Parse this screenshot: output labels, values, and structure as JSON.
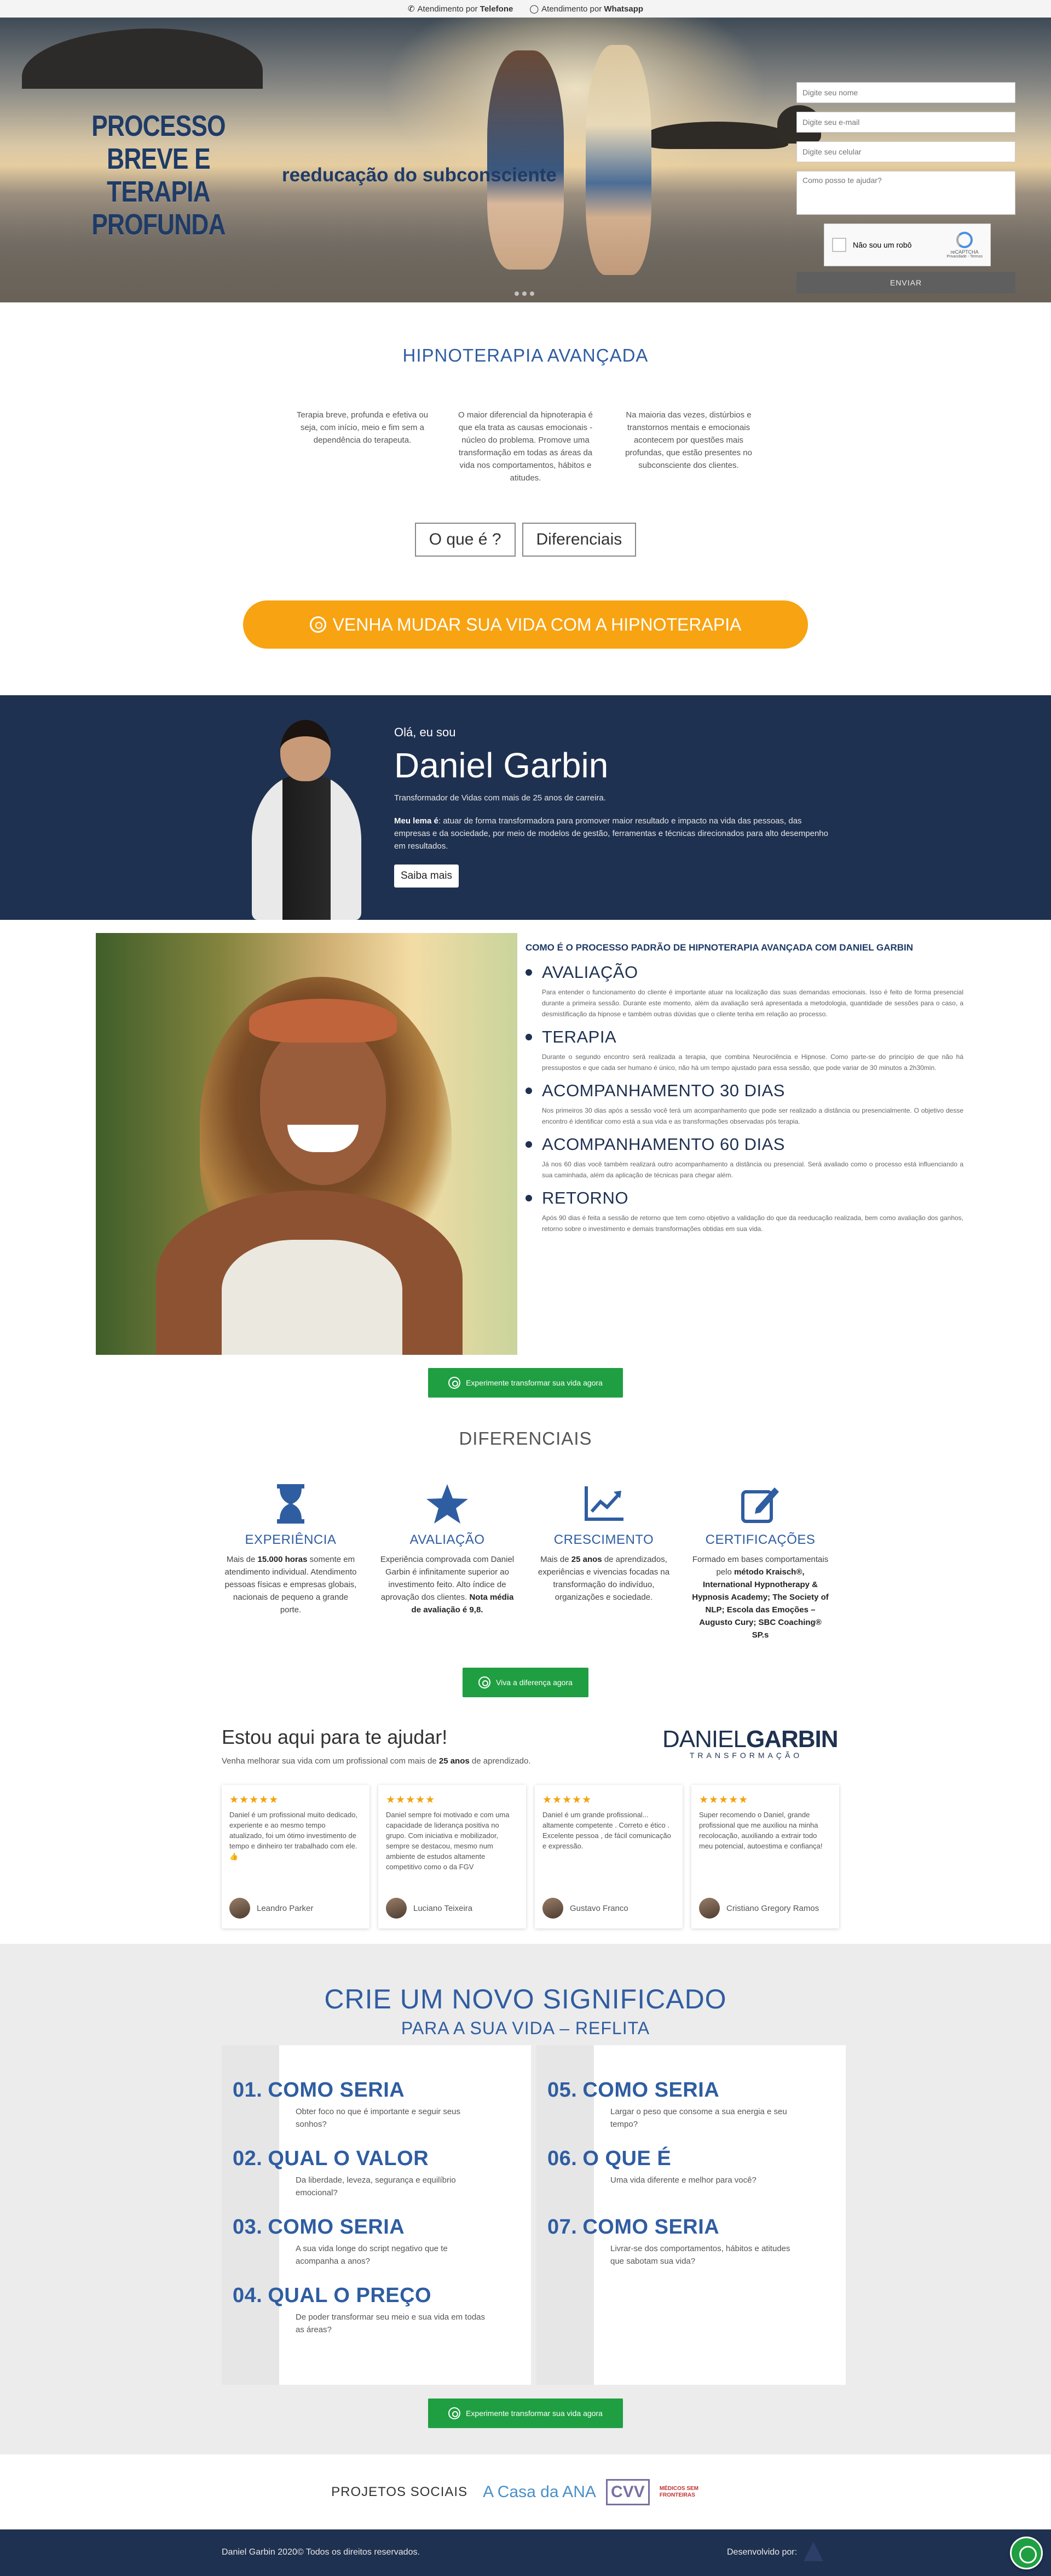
{
  "topbar": {
    "phone_prefix": "Atendimento por",
    "phone": "Telefone",
    "wa_prefix": "Atendimento por",
    "wa": "Whatsapp"
  },
  "hero": {
    "title_big": "PROCESSO BREVE E TERAPIA PROFUNDA",
    "title_small": "reeducação do subconsciente",
    "form": {
      "name_placeholder": "Digite seu nome",
      "email_placeholder": "Digite seu e-mail",
      "phone_placeholder": "Digite seu celular",
      "message_placeholder": "Como posso te ajudar?",
      "captcha_label": "Não sou um robô",
      "captcha_brand": "reCAPTCHA",
      "captcha_links": "Privacidade - Termos",
      "send_label": "ENVIAR"
    }
  },
  "hipno": {
    "title": "HIPNOTERAPIA AVANÇADA",
    "cols": [
      "Terapia breve, profunda e efetiva ou seja, com início, meio e fim sem a dependência do terapeuta.",
      "O maior diferencial da hipnoterapia é que ela trata as causas emocionais - núcleo do problema. Promove uma transformação em todas as áreas da vida nos comportamentos, hábitos e atitudes.",
      "Na maioria das vezes, distúrbios e transtornos mentais e emocionais acontecem por questões mais profundas, que estão presentes no subconsciente dos clientes."
    ],
    "tabs": [
      "O que é ?",
      "Diferenciais"
    ],
    "cta": "VENHA MUDAR SUA VIDA COM A HIPNOTERAPIA"
  },
  "about": {
    "hello": "Olá, eu sou",
    "name": "Daniel Garbin",
    "sub": "Transformador de Vidas com mais de 25 anos de carreira.",
    "lema_bold": "Meu lema é",
    "lema_rest": ": atuar de forma transformadora para promover maior resultado e impacto na vida das pessoas, das empresas e da sociedade, por meio de modelos de gestão, ferramentas e técnicas direcionados para alto desempenho em resultados.",
    "button": "Saiba mais"
  },
  "process": {
    "title": "COMO É O PROCESSO PADRÃO DE HIPNOTERAPIA AVANÇADA COM DANIEL GARBIN",
    "steps": [
      {
        "title": "AVALIAÇÃO",
        "text": "Para entender o funcionamento do cliente é importante atuar na localização das suas demandas emocionais. Isso é feito de forma presencial durante a primeira sessão. Durante este momento, além da avaliação será apresentada a metodologia, quantidade de sessões para o caso, a desmistificação da hipnose e também outras dúvidas que o cliente tenha em relação ao processo."
      },
      {
        "title": "TERAPIA",
        "text": "Durante o segundo encontro será realizada a terapia, que combina Neurociência e Hipnose. Como parte-se do princípio de que não há pressupostos e que cada ser humano é único, não há um tempo ajustado para essa sessão, que pode variar de 30 minutos a 2h30min."
      },
      {
        "title": "ACOMPANHAMENTO 30 DIAS",
        "text": "Nos primeiros 30 dias após a sessão você terá um acompanhamento que pode ser realizado a distância ou presencialmente. O objetivo desse encontro é identificar como está a sua vida e as transformações observadas pós terapia."
      },
      {
        "title": "ACOMPANHAMENTO 60 DIAS",
        "text": "Já nos 60 dias você também realizará outro acompanhamento a distância ou presencial. Será avaliado como o processo está influenciando a sua caminhada, além da aplicação de técnicas para chegar além."
      },
      {
        "title": "RETORNO",
        "text": "Após 90 dias é feita a sessão de retorno que tem como objetivo a validação do que da reeducação realizada, bem como avaliação dos ganhos, retorno sobre o investimento e demais transformações obtidas em sua vida."
      }
    ],
    "cta": "Experimente transformar sua vida agora"
  },
  "diferenciais": {
    "title": "DIFERENCIAIS",
    "items": [
      {
        "icon": "hourglass-icon",
        "title": "EXPERIÊNCIA",
        "pre": "Mais de ",
        "bold": "15.000 horas",
        "post": " somente em atendimento individual. Atendimento pessoas físicas e empresas globais, nacionais de pequeno a grande porte."
      },
      {
        "icon": "star-icon",
        "title": "AVALIAÇÃO",
        "pre": "Experiência comprovada com Daniel Garbin é infinitamente superior ao investimento feito. Alto índice de aprovação dos clientes. ",
        "bold": "Nota média de avaliação é 9,8.",
        "post": ""
      },
      {
        "icon": "chart-line-icon",
        "title": "CRESCIMENTO",
        "pre": "Mais de ",
        "bold": "25 anos",
        "post": " de aprendizados, experiências e vivencias focadas na transformação do indivíduo, organizações e sociedade."
      },
      {
        "icon": "certificate-edit-icon",
        "title": "CERTIFICAÇÕES",
        "pre": "Formado em bases comportamentais pelo ",
        "bold": "método Kraisch®, International Hypnotherapy & Hypnosis Academy; The Society of NLP; Escola das Emoções – Augusto Cury; SBC Coaching® SP.s",
        "post": ""
      }
    ],
    "cta": "Viva a diferença agora"
  },
  "help": {
    "title": "Estou aqui para te ajudar!",
    "sub_pre": "Venha melhorar sua vida com um profissional com mais de ",
    "sub_bold": "25 anos",
    "sub_post": " de aprendizado.",
    "logo_bold": "DANIEL",
    "logo_regular": "GARBIN",
    "logo_tag": "TRANSFORMAÇÃO",
    "stars": "★★★★★",
    "reviews": [
      {
        "text": "Daniel é um profissional muito dedicado, experiente e ao mesmo tempo atualizado, foi um ótimo investimento de tempo e dinheiro ter trabalhado com ele.👍",
        "name": "Leandro Parker"
      },
      {
        "text": "Daniel sempre foi motivado e com uma capacidade de liderança positiva no grupo. Com iniciativa e mobilizador, sempre se destacou, mesmo num ambiente de estudos altamente competitivo como o da FGV",
        "name": "Luciano Teixeira"
      },
      {
        "text": "Daniel é um grande profissional... altamente competente . Correto e ético . Excelente pessoa , de fácil comunicação e expressão.",
        "name": "Gustavo Franco"
      },
      {
        "text": "Super recomendo o Daniel, grande profissional que me auxiliou na minha recolocação, auxiliando a extrair todo meu potencial, autoestima e confiança!",
        "name": "Cristiano Gregory Ramos"
      }
    ]
  },
  "significado": {
    "title": "CRIE UM NOVO SIGNIFICADO",
    "subtitle": "PARA A SUA VIDA – REFLITA",
    "left": [
      {
        "num": "01.",
        "title": "COMO SERIA",
        "text": "Obter foco no que é importante e seguir seus sonhos?"
      },
      {
        "num": "02.",
        "title": "QUAL O VALOR",
        "text": "Da liberdade, leveza, segurança e equilíbrio emocional?"
      },
      {
        "num": "03.",
        "title": "COMO SERIA",
        "text": "A sua vida longe do script negativo que te acompanha a anos?"
      },
      {
        "num": "04.",
        "title": "QUAL O PREÇO",
        "text": "De poder transformar seu meio e sua vida em todas as áreas?"
      }
    ],
    "right": [
      {
        "num": "05.",
        "title": "COMO SERIA",
        "text": "Largar o peso que consome a sua energia e seu tempo?"
      },
      {
        "num": "06.",
        "title": "O QUE É",
        "text": "Uma vida diferente e melhor para você?"
      },
      {
        "num": "07.",
        "title": "COMO SERIA",
        "text": "Livrar-se dos comportamentos, hábitos e atitudes que sabotam sua vida?"
      }
    ],
    "cta": "Experimente transformar sua vida agora"
  },
  "projetos": {
    "label": "PROJETOS SOCIAIS",
    "ana": "A Casa da ANA",
    "cvv": "CVV",
    "msf": "MÉDICOS SEM FRONTEIRAS"
  },
  "footer": {
    "copy": "Daniel Garbin 2020© Todos os direitos reservados.",
    "dev": "Desenvolvido por:"
  },
  "colors": {
    "brand_blue": "#1f3150",
    "accent_blue": "#2f5da1",
    "cta_orange": "#f8a312",
    "cta_green": "#1f9f42"
  }
}
